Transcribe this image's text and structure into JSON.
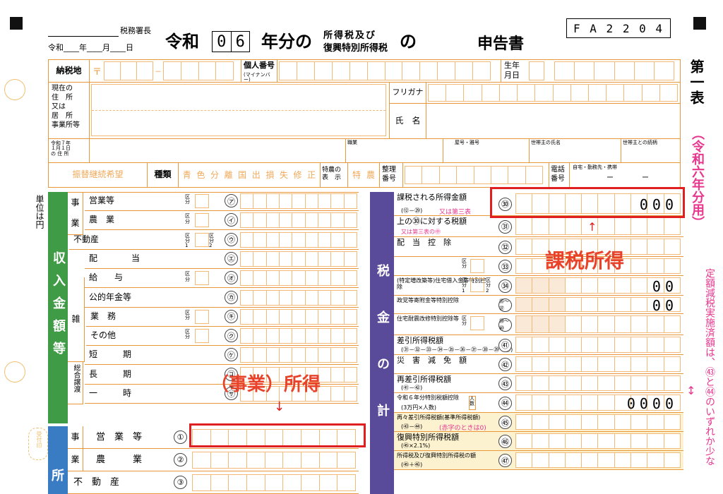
{
  "header": {
    "office_suffix": "税務署長",
    "date_line": "令和____年____月____日",
    "era": "令和",
    "year_digits": [
      "0",
      "6"
    ],
    "year_word": "年分の",
    "tax_line1": "所得税及び",
    "tax_line2": "復興特別所得税",
    "no": "の",
    "title": "申告書",
    "form_code": "F A 2 2 0 4",
    "side_title": "第一表",
    "side_sub": "（令和六年分用）",
    "side_note": "定額減税実施済額は、㊸と㊹のいずれか少な"
  },
  "info": {
    "nozeichi": "納税地",
    "postal": "〒",
    "kojin1": "個人番号",
    "kojin2": "(マイナンバー)",
    "birth1": "生年",
    "birth2": "月日",
    "genzai": "現在の\n住　所\n又は\n居　所\n事業所等",
    "furigana": "フリガナ",
    "shimei": "氏　名",
    "reiwa7": "令和７年\n１月１日\nの 住 所",
    "shokugyo": "職業",
    "yago": "屋号・雅号",
    "setainushi": "世帯主の氏名",
    "zokugara": "世帯主との続柄",
    "furikae": "振替継続希望",
    "shurui": "種類",
    "kinds": [
      "青",
      "色",
      "分",
      "離",
      "国",
      "出",
      "損",
      "失",
      "修",
      "正"
    ],
    "tokuno1": "特農の",
    "tokuno2": "表　示",
    "tokuno_chars": [
      "特",
      "農"
    ],
    "seiri1": "整理",
    "seiri2": "番号",
    "denwa1": "電話",
    "denwa2": "番号",
    "denwa_opts": "自宅・勤務先・携帯",
    "dash1": "ー",
    "dash2": "ー"
  },
  "left": {
    "unit": "単位は円",
    "income_label": "収入金額等",
    "shotoku_label": "所",
    "jigyo": "事",
    "gyo": "業",
    "rows": [
      {
        "label": "営業等",
        "kubun": "区分",
        "num": "㋐"
      },
      {
        "label": "農　業",
        "kubun": "区分",
        "num": "㋑"
      },
      {
        "label": "不動産",
        "kubun": "区分1",
        "kubun2": "区分2",
        "num": "㋒"
      },
      {
        "label": "配　　　　当",
        "num": "㋓"
      },
      {
        "label": "給　　与",
        "kubun": "区分",
        "num": "㋔"
      },
      {
        "label": "公的年金等",
        "num": "㋕"
      },
      {
        "label": "業　務",
        "kubun": "区分",
        "num": "㋖"
      },
      {
        "label": "その他",
        "kubun": "区分",
        "num": "㋗"
      },
      {
        "label": "短　　　期",
        "num": "㋘"
      },
      {
        "label": "長　　　期",
        "num": "㋙"
      },
      {
        "label": "一　　　時",
        "num": "㋚"
      }
    ],
    "zatsu": "雑",
    "sogo": "総合譲渡",
    "shotoku_rows": [
      {
        "label": "営　業　等",
        "num": "①",
        "pre": "事"
      },
      {
        "label": "農　　　業",
        "num": "②",
        "pre": "業"
      },
      {
        "label": "不　動　産",
        "num": "③"
      }
    ],
    "annot_jigyo": "（事業）所得",
    "arrow_down": "↓",
    "uketsuke": "受付印"
  },
  "right": {
    "zeikin_label": "税金の計",
    "rows": [
      {
        "l1": "課税される所得金額",
        "l2": "(⑫－㉙)",
        "l2b": "又は第三表",
        "num": "㉚",
        "val": "000"
      },
      {
        "l1": "上の㉚に対する税額",
        "l2": "又は第三表の㊥",
        "num": "㉛"
      },
      {
        "l1": "配　当　控　除",
        "num": "㉜"
      },
      {
        "l1": "",
        "kubun": "区分",
        "num": "㉝"
      },
      {
        "l1": "(特定増改築等)住宅借入金等特別控除",
        "kubun": "区分1",
        "kubun2": "区分2",
        "num": "㉞",
        "val": "00"
      },
      {
        "l1": "政党等寄附金等特別控除",
        "num": "㉟～㊲",
        "val": "00"
      },
      {
        "l1": "住宅耐震改修特別控除等",
        "kubun": "区分",
        "num": "㊳～㊵"
      },
      {
        "l1": "差引所得税額",
        "l2": "(㉛－㉜－㉝－㉞－㉟－㊱－㊲－㊳－㊴－㊵)",
        "num": "㊶"
      },
      {
        "l1": "災　害　減　免　額",
        "num": "㊷"
      },
      {
        "l1": "再差引所得税額",
        "l2": "(㊶－㊷)",
        "num": "㊸"
      },
      {
        "l1": "令和６年分特別税額控除",
        "l2": "(3万円×人数)",
        "jinsu": "人数",
        "num": "㊹",
        "val": "0000"
      },
      {
        "l1": "再々差引所得税額(基準所得税額)",
        "l2": "(㊸－㊹)",
        "l2b": "(赤字のときは0)",
        "num": "㊺"
      },
      {
        "l1": "復興特別所得税額",
        "l2": "(㊺×2.1%)",
        "num": "㊻"
      },
      {
        "l1": "所得税及び復興特別所得税の額",
        "l2": "(㊺＋㊻)",
        "num": "㊼"
      }
    ],
    "annot_kazei": "課税所得",
    "arrow_up": "↑"
  }
}
